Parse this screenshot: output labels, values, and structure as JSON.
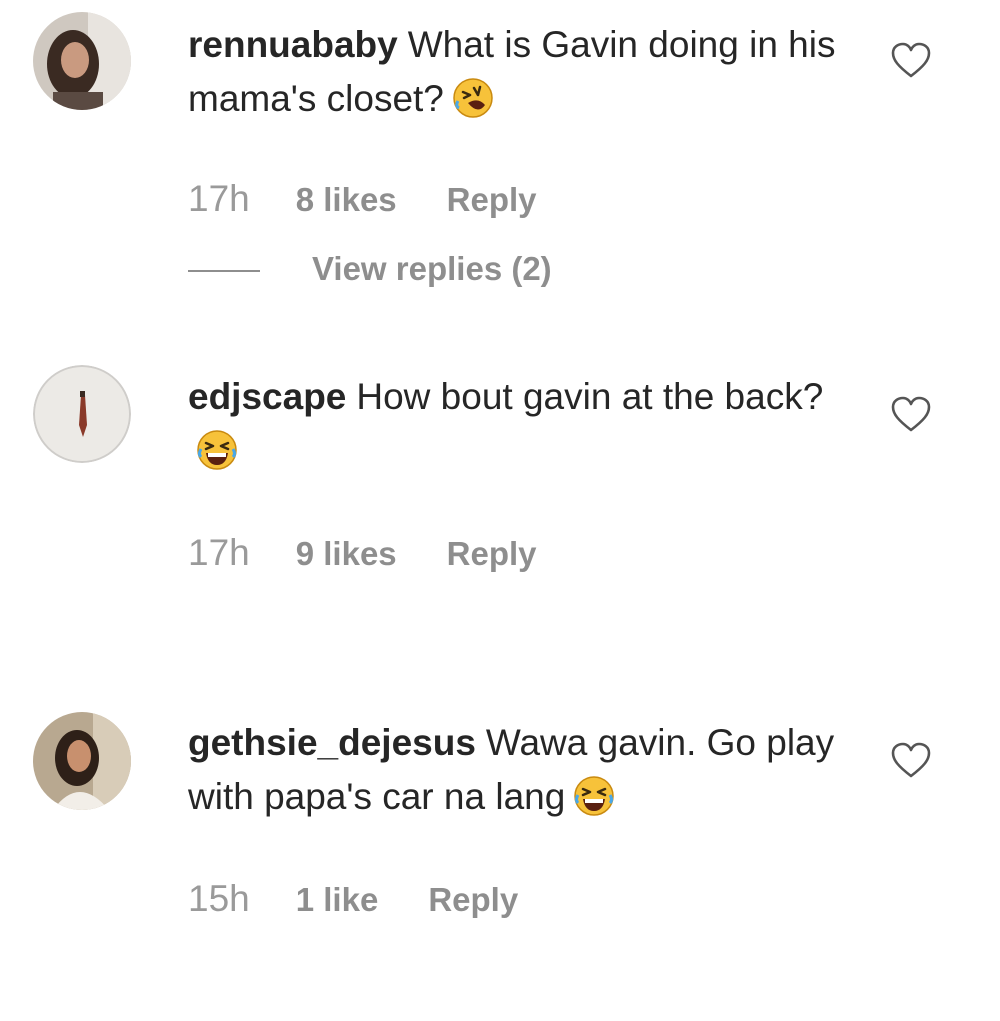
{
  "comments": [
    {
      "username": "rennuababy",
      "text": "What is Gavin doing in his mama's closet?",
      "emoji": "rolling-on-floor-laughing",
      "time": "17h",
      "likes": "8 likes",
      "reply": "Reply",
      "view_replies": "View replies (2)"
    },
    {
      "username": "edjscape",
      "text": "How bout gavin at the back?",
      "emoji": "grinning-squinting-face",
      "time": "17h",
      "likes": "9 likes",
      "reply": "Reply"
    },
    {
      "username": "gethsie_dejesus",
      "text": "Wawa gavin. Go play with papa's car na lang",
      "emoji": "grinning-squinting-face",
      "time": "15h",
      "likes": "1 like",
      "reply": "Reply"
    }
  ],
  "icons": {
    "like": "heart-outline-icon",
    "emoji_color": "#f7c23a"
  }
}
